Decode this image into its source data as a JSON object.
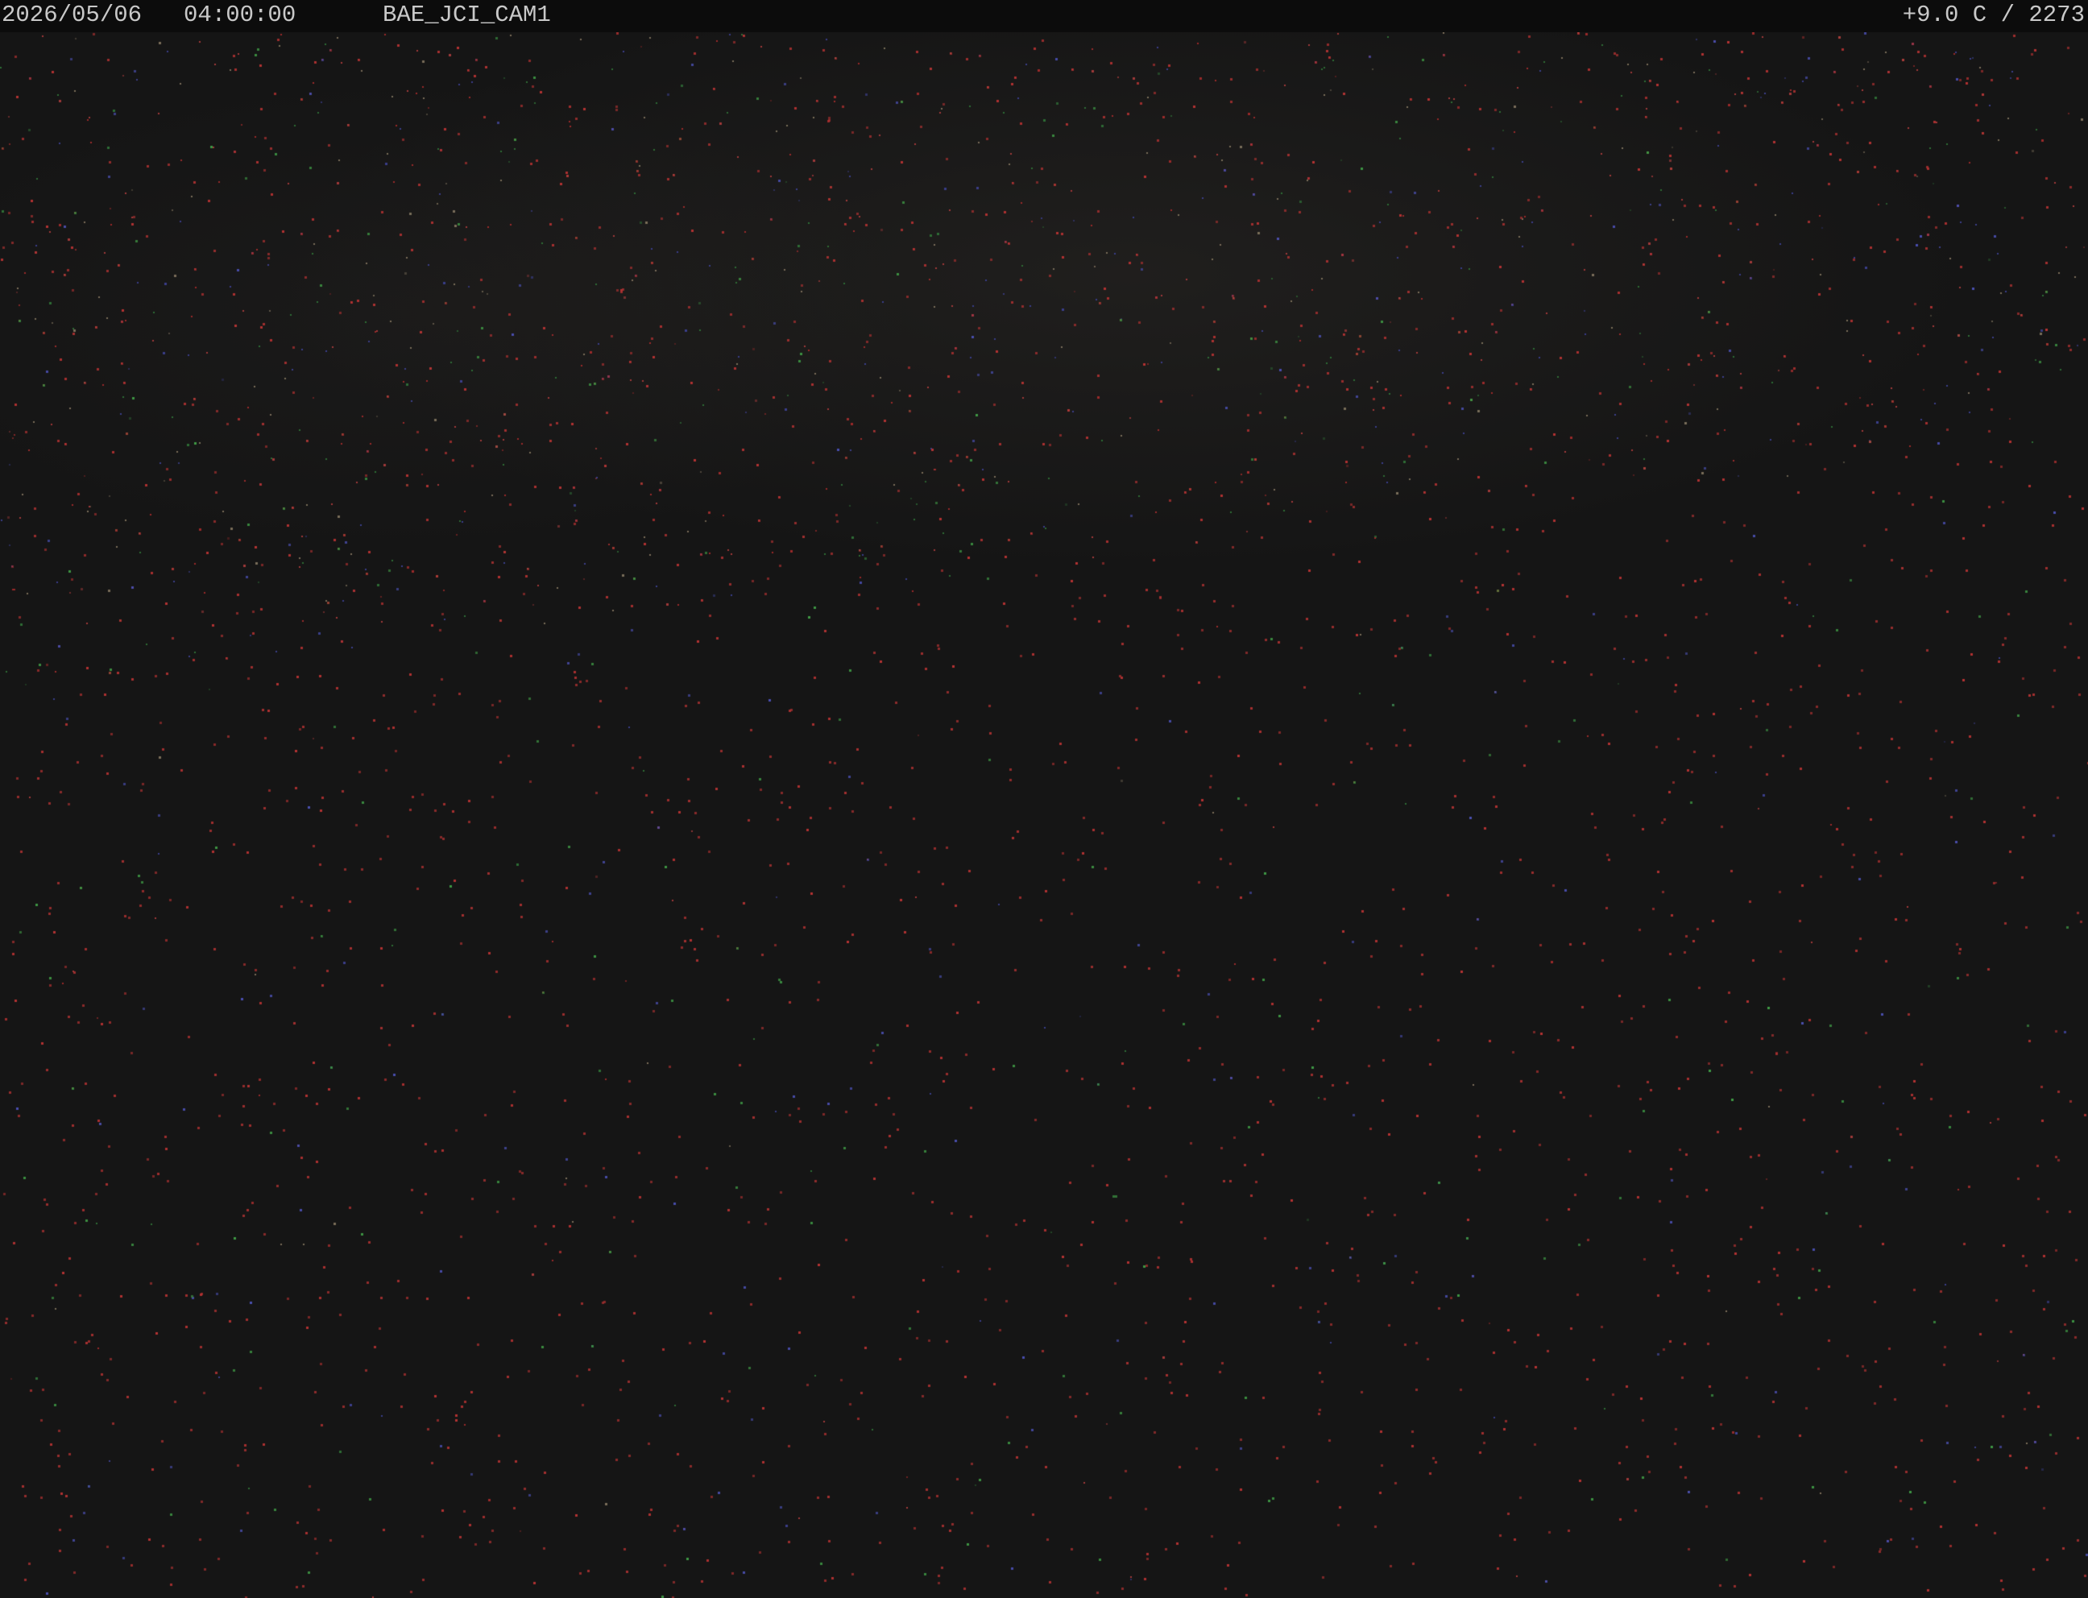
{
  "overlay": {
    "date": "2026/05/06",
    "time": "04:00:00",
    "camera_name": "BAE_JCI_CAM1",
    "temperature_altitude": "+9.0 C / 2273"
  },
  "scene": {
    "background_color": "#151515",
    "noise_colors": [
      "#9a2b2b",
      "#3b3f8a",
      "#2f6d36",
      "#7a6e5a",
      "#a03a3a"
    ]
  }
}
